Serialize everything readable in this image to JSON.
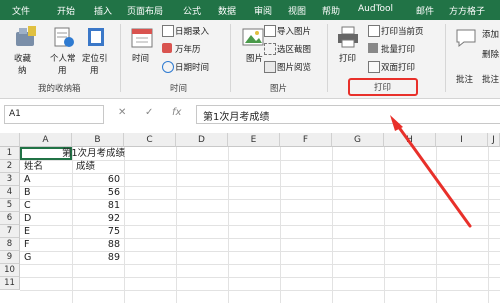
{
  "menu": [
    "文件",
    "开始",
    "插入",
    "页面布局",
    "公式",
    "数据",
    "审阅",
    "视图",
    "帮助",
    "AudTool",
    "邮件",
    "方方格子"
  ],
  "ribbon": {
    "favorites_label": "收藏",
    "favorites_label2": "纳",
    "personal_label": "个人常",
    "personal_label2": "用",
    "locate_label": "定位引",
    "locate_label2": "用",
    "group_favorites": "我的收纳箱",
    "time_label": "时间",
    "date_entry": "日期录入",
    "calendar": "万年历",
    "datetime": "日期时间",
    "group_time": "时间",
    "image_label": "图片",
    "import_image": "导入图片",
    "screenshot": "选区截图",
    "image_viewer": "图片阅览",
    "group_image": "图片",
    "print_label": "打印",
    "print_current": "打印当前页",
    "batch_print": "批量打印",
    "duplex_print": "双面打印",
    "group_print": "打印",
    "annot_label": "批注",
    "add_label": "添加",
    "delete_label": "删除",
    "annot_label2": "批注"
  },
  "formula": {
    "cell_ref": "A1",
    "fx": "fx",
    "content": "第1次月考成绩"
  },
  "columns": [
    "A",
    "B",
    "C",
    "D",
    "E",
    "F",
    "G",
    "H",
    "I",
    "J"
  ],
  "rows": [
    "1",
    "2",
    "3",
    "4",
    "5",
    "6",
    "7",
    "8",
    "9",
    "10",
    "11"
  ],
  "sheet": {
    "title": "第1次月考成绩",
    "header_name": "姓名",
    "header_score": "成绩",
    "data": [
      {
        "name": "A",
        "score": "60"
      },
      {
        "name": "B",
        "score": "56"
      },
      {
        "name": "C",
        "score": "81"
      },
      {
        "name": "D",
        "score": "92"
      },
      {
        "name": "E",
        "score": "75"
      },
      {
        "name": "F",
        "score": "88"
      },
      {
        "name": "G",
        "score": "89"
      }
    ]
  },
  "colors": {
    "accent": "#217346",
    "highlight": "#e8302a"
  }
}
